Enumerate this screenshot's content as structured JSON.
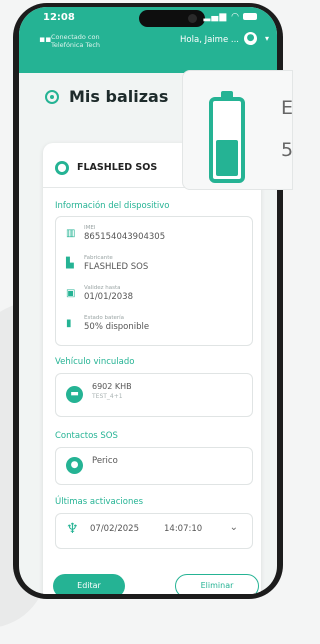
{
  "status_bar": {
    "time": "12:08"
  },
  "header": {
    "brand_line1": "Conectado con",
    "brand_line2": "Telefónica Tech",
    "user_greeting": "Hola, Jaime ..."
  },
  "page": {
    "title": "Mis balizas"
  },
  "device": {
    "name": "FLASHLED SOS",
    "section_label": "Información del dispositivo",
    "info": [
      {
        "label": "IMEI",
        "value": "865154043904305",
        "icon": "barcode-icon"
      },
      {
        "label": "Fabricante",
        "value": "FLASHLED SOS",
        "icon": "factory-icon"
      },
      {
        "label": "Validez hasta",
        "value": "01/01/2038",
        "icon": "calendar-icon"
      },
      {
        "label": "Estado batería",
        "value": "50% disponible",
        "icon": "battery-icon"
      }
    ]
  },
  "vehicle": {
    "section_label": "Vehículo vinculado",
    "plate": "6902 KHB",
    "model": "TEST_4+1"
  },
  "contacts": {
    "section_label": "Contactos SOS",
    "name": "Perico"
  },
  "activations": {
    "section_label": "Últimas activaciones",
    "date": "07/02/2025",
    "time": "14:07:10"
  },
  "actions": {
    "edit_label": "Editar",
    "delete_label": "Eliminar"
  },
  "battery_overlay": {
    "level": 0.5,
    "text_line1": "E",
    "text_line2": "5"
  },
  "colors": {
    "accent": "#25b394",
    "background": "#f1f4f3"
  }
}
